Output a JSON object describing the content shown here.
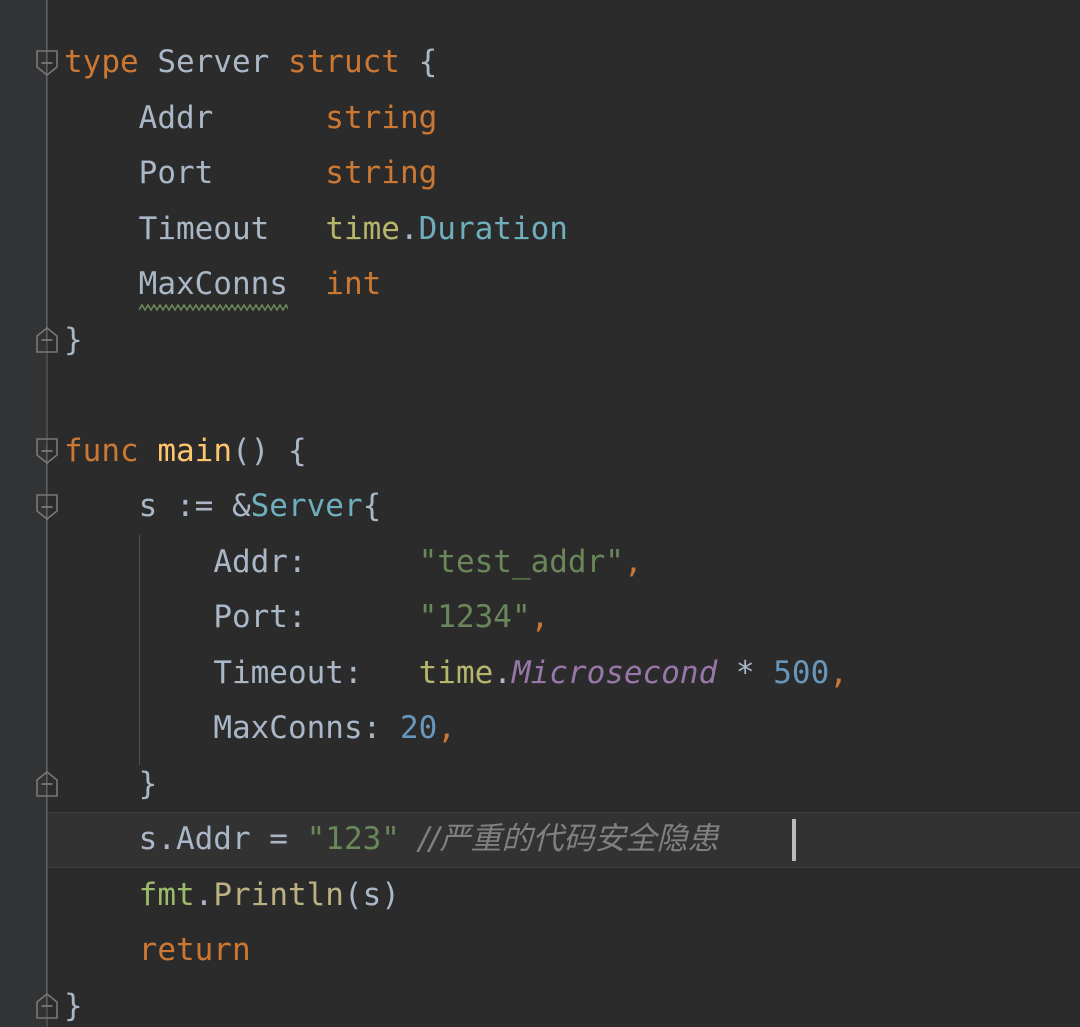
{
  "editor": {
    "language": "Go",
    "background": "#2b2b2b",
    "gutter_background": "#313335",
    "current_line_background": "#323232",
    "caret_color": "#bbbbbb",
    "font_size_px": 31,
    "line_height_px": 55.5
  },
  "colors": {
    "keyword": "#cc7832",
    "identifier": "#a9b7c6",
    "function_name": "#ffc66d",
    "type_name": "#6fafbd",
    "number": "#6897bb",
    "string": "#6a8759",
    "package_time": "#b5b66b",
    "package_fmt": "#9bbb68",
    "constant": "#9876aa",
    "method": "#bdb182",
    "comment": "#808080",
    "warning_squiggle": "#6a8759",
    "indent_guide": "#4e5254",
    "fold_marker": "#787878"
  },
  "code": {
    "lines": [
      {
        "n": 1,
        "indent": 0,
        "tokens": [
          {
            "t": "type",
            "c": "kw"
          },
          {
            "t": " ",
            "c": "plain"
          },
          {
            "t": "Server",
            "c": "plain"
          },
          {
            "t": " ",
            "c": "plain"
          },
          {
            "t": "struct",
            "c": "kw"
          },
          {
            "t": " {",
            "c": "plain"
          }
        ]
      },
      {
        "n": 2,
        "indent": 1,
        "tokens": [
          {
            "t": "Addr",
            "c": "plain"
          },
          {
            "t": "      ",
            "c": "plain"
          },
          {
            "t": "string",
            "c": "kw"
          }
        ]
      },
      {
        "n": 3,
        "indent": 1,
        "tokens": [
          {
            "t": "Port",
            "c": "plain"
          },
          {
            "t": "      ",
            "c": "plain"
          },
          {
            "t": "string",
            "c": "kw"
          }
        ]
      },
      {
        "n": 4,
        "indent": 1,
        "tokens": [
          {
            "t": "Timeout",
            "c": "plain"
          },
          {
            "t": "   ",
            "c": "plain"
          },
          {
            "t": "time",
            "c": "pkg"
          },
          {
            "t": ".",
            "c": "plain"
          },
          {
            "t": "Duration",
            "c": "typ"
          }
        ]
      },
      {
        "n": 5,
        "indent": 1,
        "tokens": [
          {
            "t": "MaxConns",
            "c": "plain"
          },
          {
            "t": "  ",
            "c": "plain"
          },
          {
            "t": "int",
            "c": "kw"
          }
        ]
      },
      {
        "n": 6,
        "indent": 0,
        "tokens": [
          {
            "t": "}",
            "c": "plain"
          }
        ]
      },
      {
        "n": 7,
        "indent": 0,
        "tokens": []
      },
      {
        "n": 8,
        "indent": 0,
        "tokens": [
          {
            "t": "func",
            "c": "kw"
          },
          {
            "t": " ",
            "c": "plain"
          },
          {
            "t": "main",
            "c": "fn"
          },
          {
            "t": "() {",
            "c": "plain"
          }
        ]
      },
      {
        "n": 9,
        "indent": 1,
        "tokens": [
          {
            "t": "s := &",
            "c": "plain"
          },
          {
            "t": "Server",
            "c": "typ"
          },
          {
            "t": "{",
            "c": "plain"
          }
        ]
      },
      {
        "n": 10,
        "indent": 2,
        "tokens": [
          {
            "t": "Addr:",
            "c": "plain"
          },
          {
            "t": "      ",
            "c": "plain"
          },
          {
            "t": "\"test_addr\"",
            "c": "str"
          },
          {
            "t": ",",
            "c": "kw"
          }
        ]
      },
      {
        "n": 11,
        "indent": 2,
        "tokens": [
          {
            "t": "Port:",
            "c": "plain"
          },
          {
            "t": "      ",
            "c": "plain"
          },
          {
            "t": "\"1234\"",
            "c": "str"
          },
          {
            "t": ",",
            "c": "kw"
          }
        ]
      },
      {
        "n": 12,
        "indent": 2,
        "tokens": [
          {
            "t": "Timeout:",
            "c": "plain"
          },
          {
            "t": "   ",
            "c": "plain"
          },
          {
            "t": "time",
            "c": "pkg"
          },
          {
            "t": ".",
            "c": "plain"
          },
          {
            "t": "Microsecond",
            "c": "const"
          },
          {
            "t": " * ",
            "c": "plain"
          },
          {
            "t": "500",
            "c": "num"
          },
          {
            "t": ",",
            "c": "kw"
          }
        ]
      },
      {
        "n": 13,
        "indent": 2,
        "tokens": [
          {
            "t": "MaxConns:",
            "c": "plain"
          },
          {
            "t": " ",
            "c": "plain"
          },
          {
            "t": "20",
            "c": "num"
          },
          {
            "t": ",",
            "c": "kw"
          }
        ]
      },
      {
        "n": 14,
        "indent": 1,
        "tokens": [
          {
            "t": "}",
            "c": "plain"
          }
        ]
      },
      {
        "n": 15,
        "indent": 1,
        "current": true,
        "tokens": [
          {
            "t": "s.Addr = ",
            "c": "plain"
          },
          {
            "t": "\"123\"",
            "c": "str"
          },
          {
            "t": " ",
            "c": "plain"
          },
          {
            "t": "//严重的代码安全隐患",
            "c": "comment cn"
          }
        ]
      },
      {
        "n": 16,
        "indent": 1,
        "tokens": [
          {
            "t": "fmt",
            "c": "pkg2"
          },
          {
            "t": ".",
            "c": "plain"
          },
          {
            "t": "Println",
            "c": "method"
          },
          {
            "t": "(s)",
            "c": "plain"
          }
        ]
      },
      {
        "n": 17,
        "indent": 1,
        "tokens": [
          {
            "t": "return",
            "c": "kw"
          }
        ]
      },
      {
        "n": 18,
        "indent": 0,
        "tokens": [
          {
            "t": "}",
            "c": "plain"
          }
        ]
      }
    ]
  },
  "gutter": {
    "fold_markers": [
      {
        "name": "fold-start-type-server",
        "line": 1,
        "kind": "start",
        "symbol": "minus"
      },
      {
        "name": "fold-end-type-server",
        "line": 6,
        "kind": "end",
        "symbol": "minus"
      },
      {
        "name": "fold-start-func-main",
        "line": 8,
        "kind": "start",
        "symbol": "minus"
      },
      {
        "name": "fold-start-struct-lit",
        "line": 9,
        "kind": "start",
        "symbol": "minus"
      },
      {
        "name": "fold-end-struct-lit",
        "line": 14,
        "kind": "end",
        "symbol": "minus"
      },
      {
        "name": "fold-end-func-main",
        "line": 18,
        "kind": "end",
        "symbol": "minus"
      }
    ]
  },
  "annotations": {
    "squiggle": {
      "target": "MaxConns",
      "line": 5,
      "color": "#6a8759",
      "severity": "warning"
    },
    "caret": {
      "line": 15,
      "after_text": "//严重的代码安全隐患"
    }
  }
}
